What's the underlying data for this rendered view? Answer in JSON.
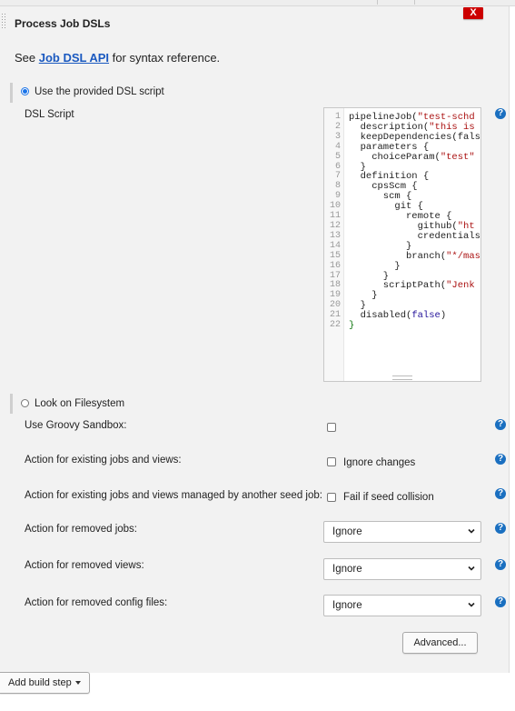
{
  "section": {
    "title": "Process Job DSLs",
    "close_label": "X"
  },
  "reference": {
    "prefix": "See ",
    "link_text": "Job DSL API",
    "suffix": " for syntax reference."
  },
  "options": {
    "provided_script_label": "Use the provided DSL script",
    "provided_script_selected": true,
    "filesystem_label": "Look on Filesystem",
    "filesystem_selected": false
  },
  "dsl_script": {
    "label": "DSL Script",
    "line_numbers": [
      "1",
      "2",
      "3",
      "4",
      "5",
      "6",
      "7",
      "8",
      "9",
      "10",
      "11",
      "12",
      "13",
      "14",
      "15",
      "16",
      "17",
      "18",
      "19",
      "20",
      "21",
      "22"
    ],
    "lines": [
      "pipelineJob(\"test-schd",
      "  description(\"this is",
      "  keepDependencies(fals",
      "  parameters {",
      "    choiceParam(\"test\"",
      "  }",
      "  definition {",
      "    cpsScm {",
      "      scm {",
      "        git {",
      "          remote {",
      "            github(\"ht",
      "            credentials",
      "          }",
      "          branch(\"*/mas",
      "        }",
      "      }",
      "      scriptPath(\"Jenk",
      "    }",
      "  }",
      "  disabled(false)",
      "}"
    ]
  },
  "fields": {
    "groovy_sandbox_label": "Use Groovy Sandbox:",
    "groovy_sandbox_checked": false,
    "existing_jobs_label": "Action for existing jobs and views:",
    "ignore_changes_label": "Ignore changes",
    "ignore_changes_checked": false,
    "managed_jobs_label": "Action for existing jobs and views managed by another seed job:",
    "fail_collision_label": "Fail if seed collision",
    "fail_collision_checked": false,
    "removed_jobs_label": "Action for removed jobs:",
    "removed_jobs_value": "Ignore",
    "removed_views_label": "Action for removed views:",
    "removed_views_value": "Ignore",
    "removed_config_label": "Action for removed config files:",
    "removed_config_value": "Ignore"
  },
  "buttons": {
    "advanced": "Advanced...",
    "add_build_step": "Add build step"
  },
  "icons": {
    "help": "help-icon",
    "help_symbol": "?",
    "chevron": "chevron-down-icon",
    "close": "close-icon"
  },
  "colors": {
    "close_red": "#cc0000",
    "link_blue": "#1a59c0",
    "help_blue": "#1a6fc0",
    "panel_bg": "#f2f2f2"
  }
}
